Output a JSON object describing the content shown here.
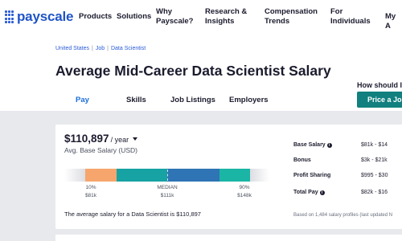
{
  "brand": {
    "name": "payscale",
    "color": "#1f54c7"
  },
  "nav": {
    "items": [
      {
        "line1": "Products",
        "line2": ""
      },
      {
        "line1": "Solutions",
        "line2": ""
      },
      {
        "line1": "Why",
        "line2": "Payscale?"
      },
      {
        "line1": "Research &",
        "line2": "Insights"
      },
      {
        "line1": "Compensation",
        "line2": "Trends"
      },
      {
        "line1": "For",
        "line2": "Individuals"
      },
      {
        "line1": "My A",
        "line2": ""
      }
    ]
  },
  "breadcrumb": [
    "United States",
    "Job",
    "Data Scientist"
  ],
  "page_title": "Average Mid-Career Data Scientist Salary",
  "tabs": [
    "Pay",
    "Skills",
    "Job Listings",
    "Employers"
  ],
  "sidebar_cta": {
    "question": "How should I",
    "button": "Price a Jo"
  },
  "summary": {
    "salary": "$110,897",
    "period": "/ year",
    "label": "Avg. Base Salary (USD)",
    "note": "The average salary for a Data Scientist is $110,897"
  },
  "range": {
    "p10_label": "10%",
    "p10_value": "$81k",
    "median_label": "MEDIAN",
    "median_value": "$111k",
    "p90_label": "90%",
    "p90_value": "$148k",
    "colors": {
      "low": "#f6a66d",
      "mid": "#17a2a3",
      "center": "#2f74b5",
      "high": "#1ab5a5"
    }
  },
  "breakdown": [
    {
      "label": "Base Salary",
      "info": true,
      "value": "$81k - $14"
    },
    {
      "label": "Bonus",
      "info": false,
      "value": "$3k - $21k"
    },
    {
      "label": "Profit Sharing",
      "info": false,
      "value": "$995 - $30"
    },
    {
      "label": "Total Pay",
      "info": true,
      "value": "$82k - $16"
    }
  ],
  "based_on": "Based on 1,484 salary profiles (last updated N"
}
